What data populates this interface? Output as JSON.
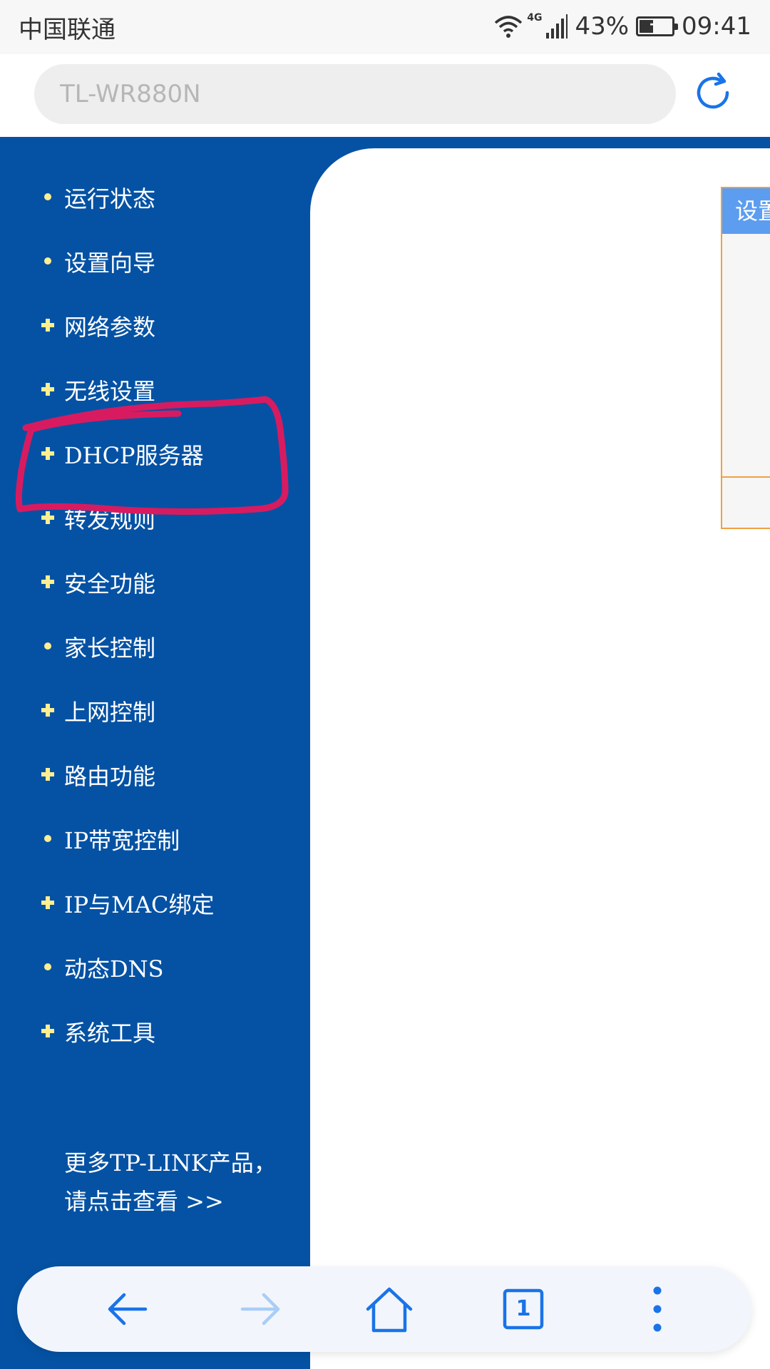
{
  "status_bar": {
    "carrier": "中国联通",
    "network_type": "4G",
    "battery_percent": "43%",
    "battery_level": 0.43,
    "time": "09:41"
  },
  "address_bar": {
    "url": "TL-WR880N"
  },
  "sidebar": {
    "items": [
      {
        "label": "运行状态",
        "marker": "bullet"
      },
      {
        "label": "设置向导",
        "marker": "bullet"
      },
      {
        "label": "网络参数",
        "marker": "plus"
      },
      {
        "label": "无线设置",
        "marker": "plus"
      },
      {
        "label": "DHCP服务器",
        "marker": "plus"
      },
      {
        "label": "转发规则",
        "marker": "plus"
      },
      {
        "label": "安全功能",
        "marker": "plus"
      },
      {
        "label": "家长控制",
        "marker": "bullet"
      },
      {
        "label": "上网控制",
        "marker": "plus"
      },
      {
        "label": "路由功能",
        "marker": "plus"
      },
      {
        "label": "IP带宽控制",
        "marker": "bullet"
      },
      {
        "label": "IP与MAC绑定",
        "marker": "plus"
      },
      {
        "label": "动态DNS",
        "marker": "bullet"
      },
      {
        "label": "系统工具",
        "marker": "plus"
      }
    ],
    "more_line1": "更多TP-LINK产品，",
    "more_line2": "请点击查看 >>"
  },
  "content": {
    "box_header": "设置"
  },
  "bottom_nav": {
    "tab_count": "1"
  },
  "colors": {
    "sidebar_bg": "#0552a4",
    "marker": "#ffef90",
    "annotation": "#d81b60",
    "accent": "#1a73e8",
    "box_border": "#f0a040",
    "box_header": "#5c9df0"
  }
}
